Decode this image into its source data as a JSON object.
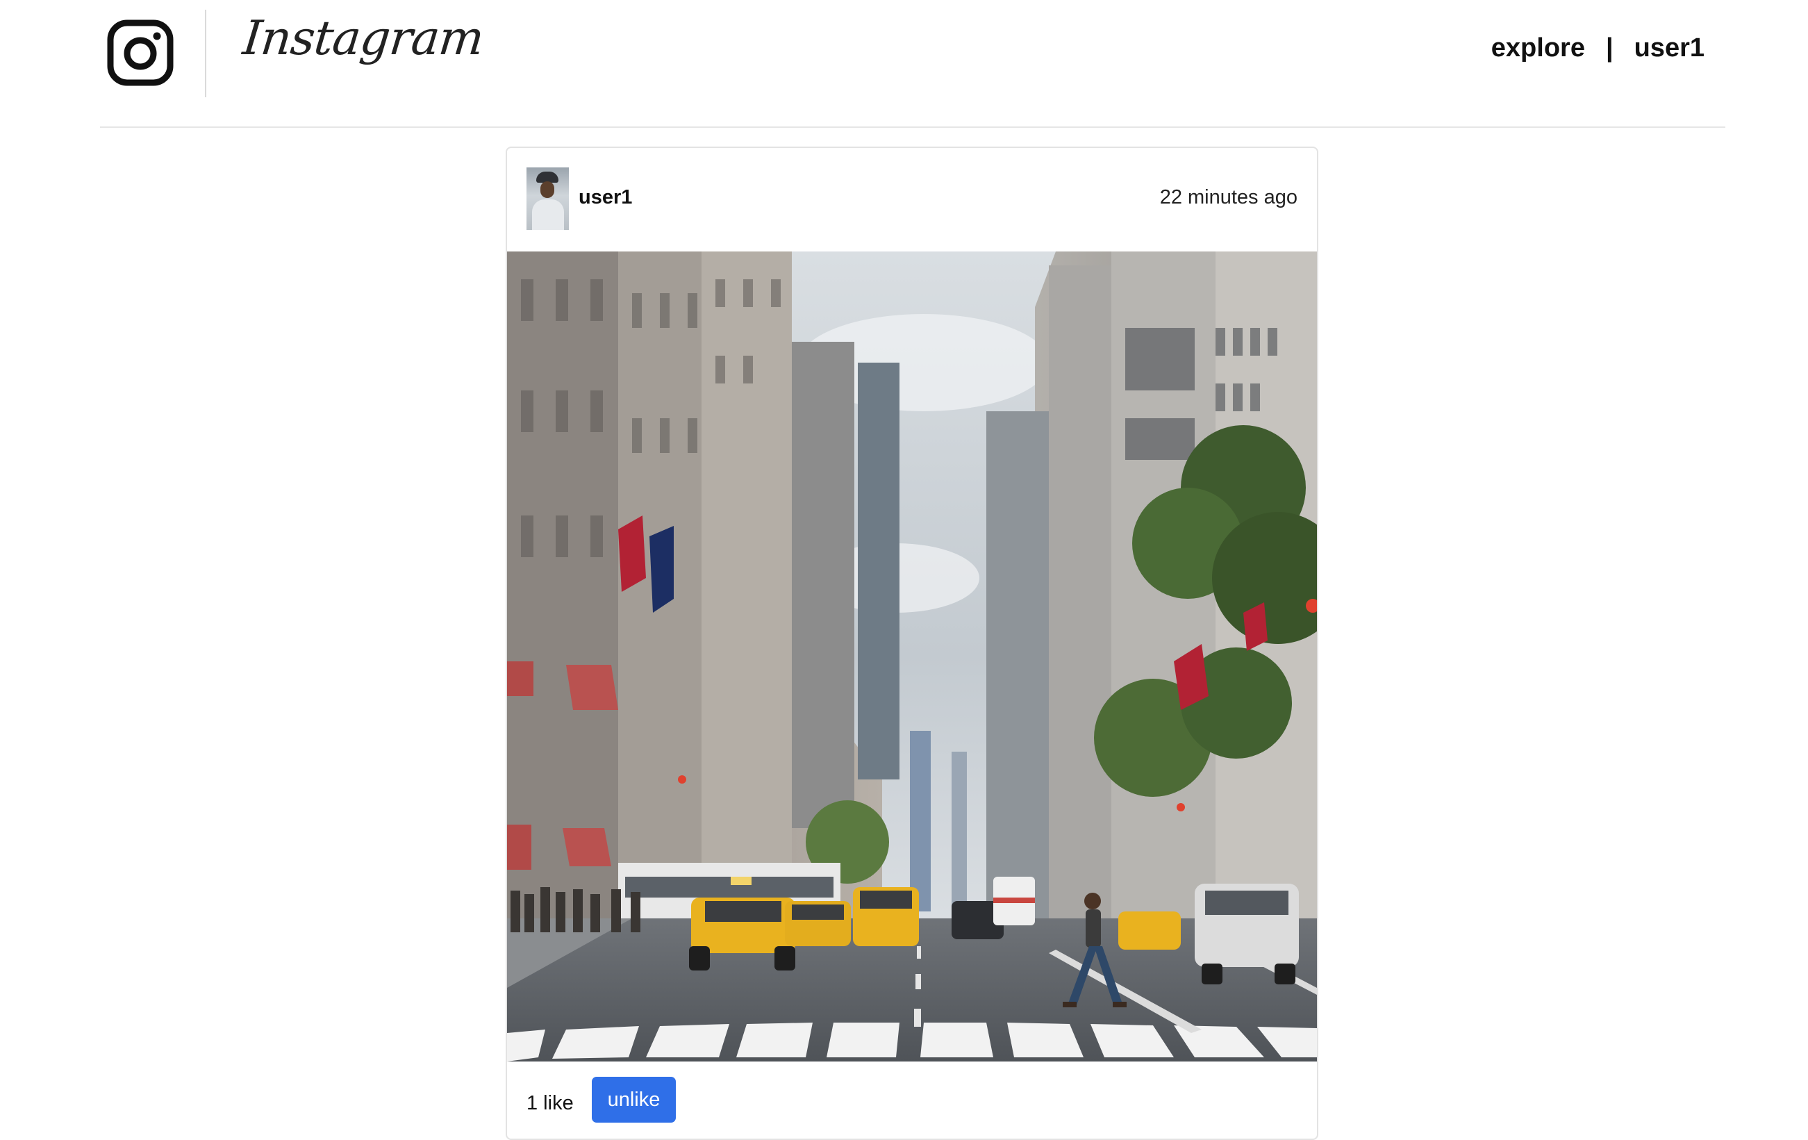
{
  "header": {
    "brand": "Instagram",
    "nav": {
      "explore_label": "explore",
      "separator": "|",
      "user_label": "user1"
    }
  },
  "post": {
    "username": "user1",
    "timestamp": "22 minutes ago",
    "image_subject": "city street with yellow taxis and skyscrapers",
    "likes_text": "1 like",
    "unlike_label": "unlike"
  },
  "colors": {
    "button_blue": "#2f6fe8",
    "taxi_yellow": "#e9b21f",
    "divider": "#e6e6e6"
  },
  "icons": {
    "logo": "instagram-camera-icon"
  }
}
